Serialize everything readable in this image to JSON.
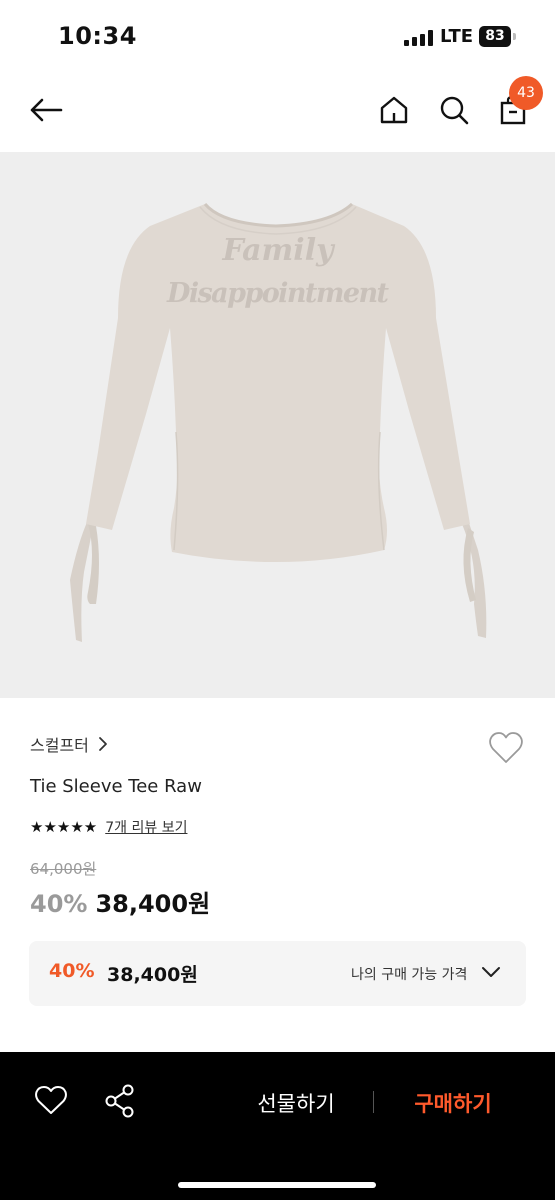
{
  "status_bar": {
    "time": "10:34",
    "network": "LTE",
    "battery": "83"
  },
  "nav": {
    "cart_count": "43"
  },
  "product_image": {
    "print_line1": "Family",
    "print_line2": "Disappointment"
  },
  "product": {
    "brand": "스컬프터",
    "name": "Tie Sleeve Tee Raw",
    "rating_stars": 5,
    "stars_text": "★★★★★",
    "review_link": "7개 리뷰 보기",
    "original_price": "64,000원",
    "discount": "40%",
    "price": "38,400원"
  },
  "my_price": {
    "discount": "40%",
    "price": "38,400원",
    "label": "나의 구매 가능 가격"
  },
  "bottom_bar": {
    "gift_label": "선물하기",
    "buy_label": "구매하기"
  },
  "colors": {
    "accent": "#f05a28",
    "buy": "#ff5a2c",
    "image_bg": "#eeeeee",
    "tee": "#e0d9d2"
  }
}
